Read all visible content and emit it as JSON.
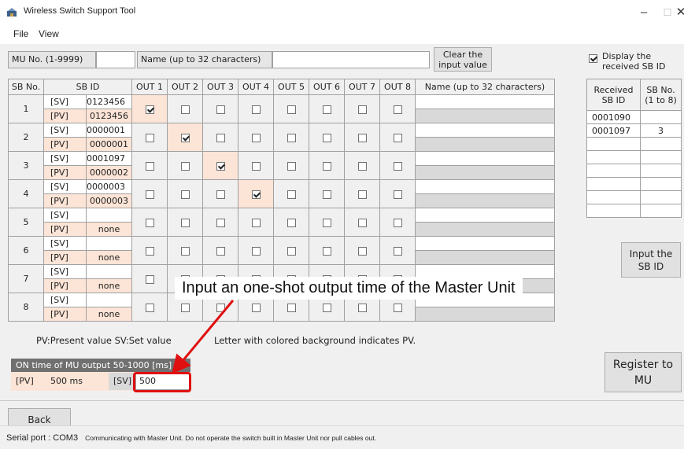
{
  "window": {
    "title": "Wireless Switch Support Tool",
    "minimize": "–",
    "maximize": "☐",
    "close": "✕"
  },
  "menu": [
    "File",
    "View"
  ],
  "header": {
    "mu_no_label": "MU No. (1-9999)",
    "mu_no_value": "",
    "name_label": "Name (up to 32 characters)",
    "name_value": "",
    "clear_button": "Clear the input value"
  },
  "table": {
    "headers": {
      "sb_no": "SB No.",
      "sb_id": "SB ID",
      "outs": [
        "OUT 1",
        "OUT 2",
        "OUT 3",
        "OUT 4",
        "OUT 5",
        "OUT 6",
        "OUT 7",
        "OUT 8"
      ],
      "name": "Name (up to 32 characters)"
    },
    "sv_tag": "[SV]",
    "pv_tag": "[PV]",
    "rows": [
      {
        "no": "1",
        "sv": "0123456",
        "pv": "0123456",
        "outs": [
          true,
          false,
          false,
          false,
          false,
          false,
          false,
          false
        ],
        "name": ""
      },
      {
        "no": "2",
        "sv": "0000001",
        "pv": "0000001",
        "outs": [
          false,
          true,
          false,
          false,
          false,
          false,
          false,
          false
        ],
        "name": ""
      },
      {
        "no": "3",
        "sv": "0001097",
        "pv": "0000002",
        "outs": [
          false,
          false,
          true,
          false,
          false,
          false,
          false,
          false
        ],
        "name": ""
      },
      {
        "no": "4",
        "sv": "0000003",
        "pv": "0000003",
        "outs": [
          false,
          false,
          false,
          true,
          false,
          false,
          false,
          false
        ],
        "name": ""
      },
      {
        "no": "5",
        "sv": "",
        "pv": "none",
        "outs": [
          false,
          false,
          false,
          false,
          false,
          false,
          false,
          false
        ],
        "name": ""
      },
      {
        "no": "6",
        "sv": "",
        "pv": "none",
        "outs": [
          false,
          false,
          false,
          false,
          false,
          false,
          false,
          false
        ],
        "name": ""
      },
      {
        "no": "7",
        "sv": "",
        "pv": "none",
        "outs": [
          false,
          false,
          false,
          false,
          false,
          false,
          false,
          false
        ],
        "name": ""
      },
      {
        "no": "8",
        "sv": "",
        "pv": "none",
        "outs": [
          false,
          false,
          false,
          false,
          false,
          false,
          false,
          false
        ],
        "name": ""
      }
    ]
  },
  "legend": {
    "line1": "PV:Present value  SV:Set value",
    "line2": "Letter with colored background indicates PV."
  },
  "mu_output": {
    "header": "ON time of MU output 50-1000 [ms]",
    "pv_tag": "[PV]",
    "pv_value": "500 ms",
    "sv_tag": "[SV]",
    "sv_value": "500"
  },
  "annotation": "Input an one-shot output time of the Master Unit",
  "right_panel": {
    "display_checkbox_label": "Display the received SB ID",
    "display_checked": true,
    "col1": "Received SB ID",
    "col2": "SB No. (1 to 8)",
    "rows": [
      {
        "id": "0001090",
        "no": ""
      },
      {
        "id": "0001097",
        "no": "3"
      },
      {
        "id": "",
        "no": ""
      },
      {
        "id": "",
        "no": ""
      },
      {
        "id": "",
        "no": ""
      },
      {
        "id": "",
        "no": ""
      },
      {
        "id": "",
        "no": ""
      },
      {
        "id": "",
        "no": ""
      }
    ],
    "input_button": "Input the SB ID",
    "register_button": "Register to MU"
  },
  "back_button": "Back",
  "status": {
    "label": "Serial port :  COM3",
    "message": "Communicating with Master Unit. Do not operate the switch built in Master Unit nor pull cables out."
  },
  "colors": {
    "pv_bg": "#fce4d6",
    "annotation_red": "#e01010"
  }
}
